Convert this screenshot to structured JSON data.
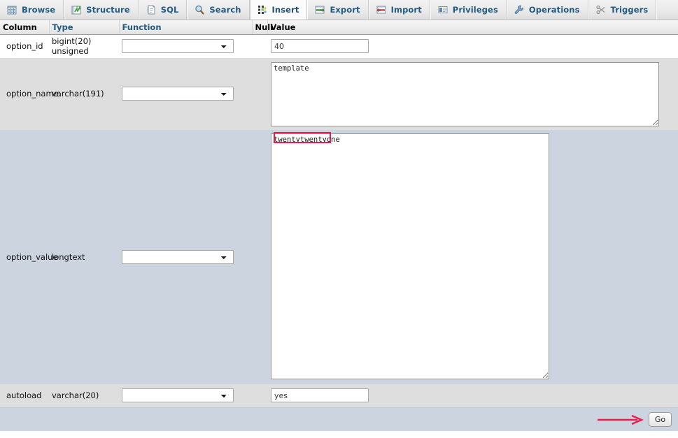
{
  "tabs": [
    {
      "label": "Browse",
      "icon": "browse-grid-icon",
      "active": false
    },
    {
      "label": "Structure",
      "icon": "structure-icon",
      "active": false
    },
    {
      "label": "SQL",
      "icon": "sql-document-icon",
      "active": false
    },
    {
      "label": "Search",
      "icon": "search-icon",
      "active": false
    },
    {
      "label": "Insert",
      "icon": "insert-icon",
      "active": true
    },
    {
      "label": "Export",
      "icon": "export-icon",
      "active": false
    },
    {
      "label": "Import",
      "icon": "import-icon",
      "active": false
    },
    {
      "label": "Privileges",
      "icon": "privileges-icon",
      "active": false
    },
    {
      "label": "Operations",
      "icon": "operations-wrench-icon",
      "active": false
    },
    {
      "label": "Triggers",
      "icon": "triggers-icon",
      "active": false
    }
  ],
  "table": {
    "headers": {
      "column": "Column",
      "type": "Type",
      "function": "Function",
      "null": "Null",
      "value": "Value"
    },
    "rows": [
      {
        "column": "option_id",
        "type": "bigint(20) unsigned",
        "function": "",
        "value": "40",
        "input_kind": "text"
      },
      {
        "column": "option_name",
        "type": "varchar(191)",
        "function": "",
        "value": "template",
        "input_kind": "textarea"
      },
      {
        "column": "option_value",
        "type": "longtext",
        "function": "",
        "value": "twentytwentyone",
        "input_kind": "textarea-large"
      },
      {
        "column": "autoload",
        "type": "varchar(20)",
        "function": "",
        "value": "yes",
        "input_kind": "text"
      }
    ]
  },
  "footer": {
    "go_label": "Go"
  },
  "annotations": {
    "highlight_color": "#e61e50",
    "arrow_color": "#e61e50",
    "highlight_target": "twentytwentyone",
    "arrow_target": "Go"
  },
  "colors": {
    "tab_link": "#235a81",
    "row_white": "#ffffff",
    "row_gray": "#dedede",
    "row_blue": "#ccd4e0"
  }
}
